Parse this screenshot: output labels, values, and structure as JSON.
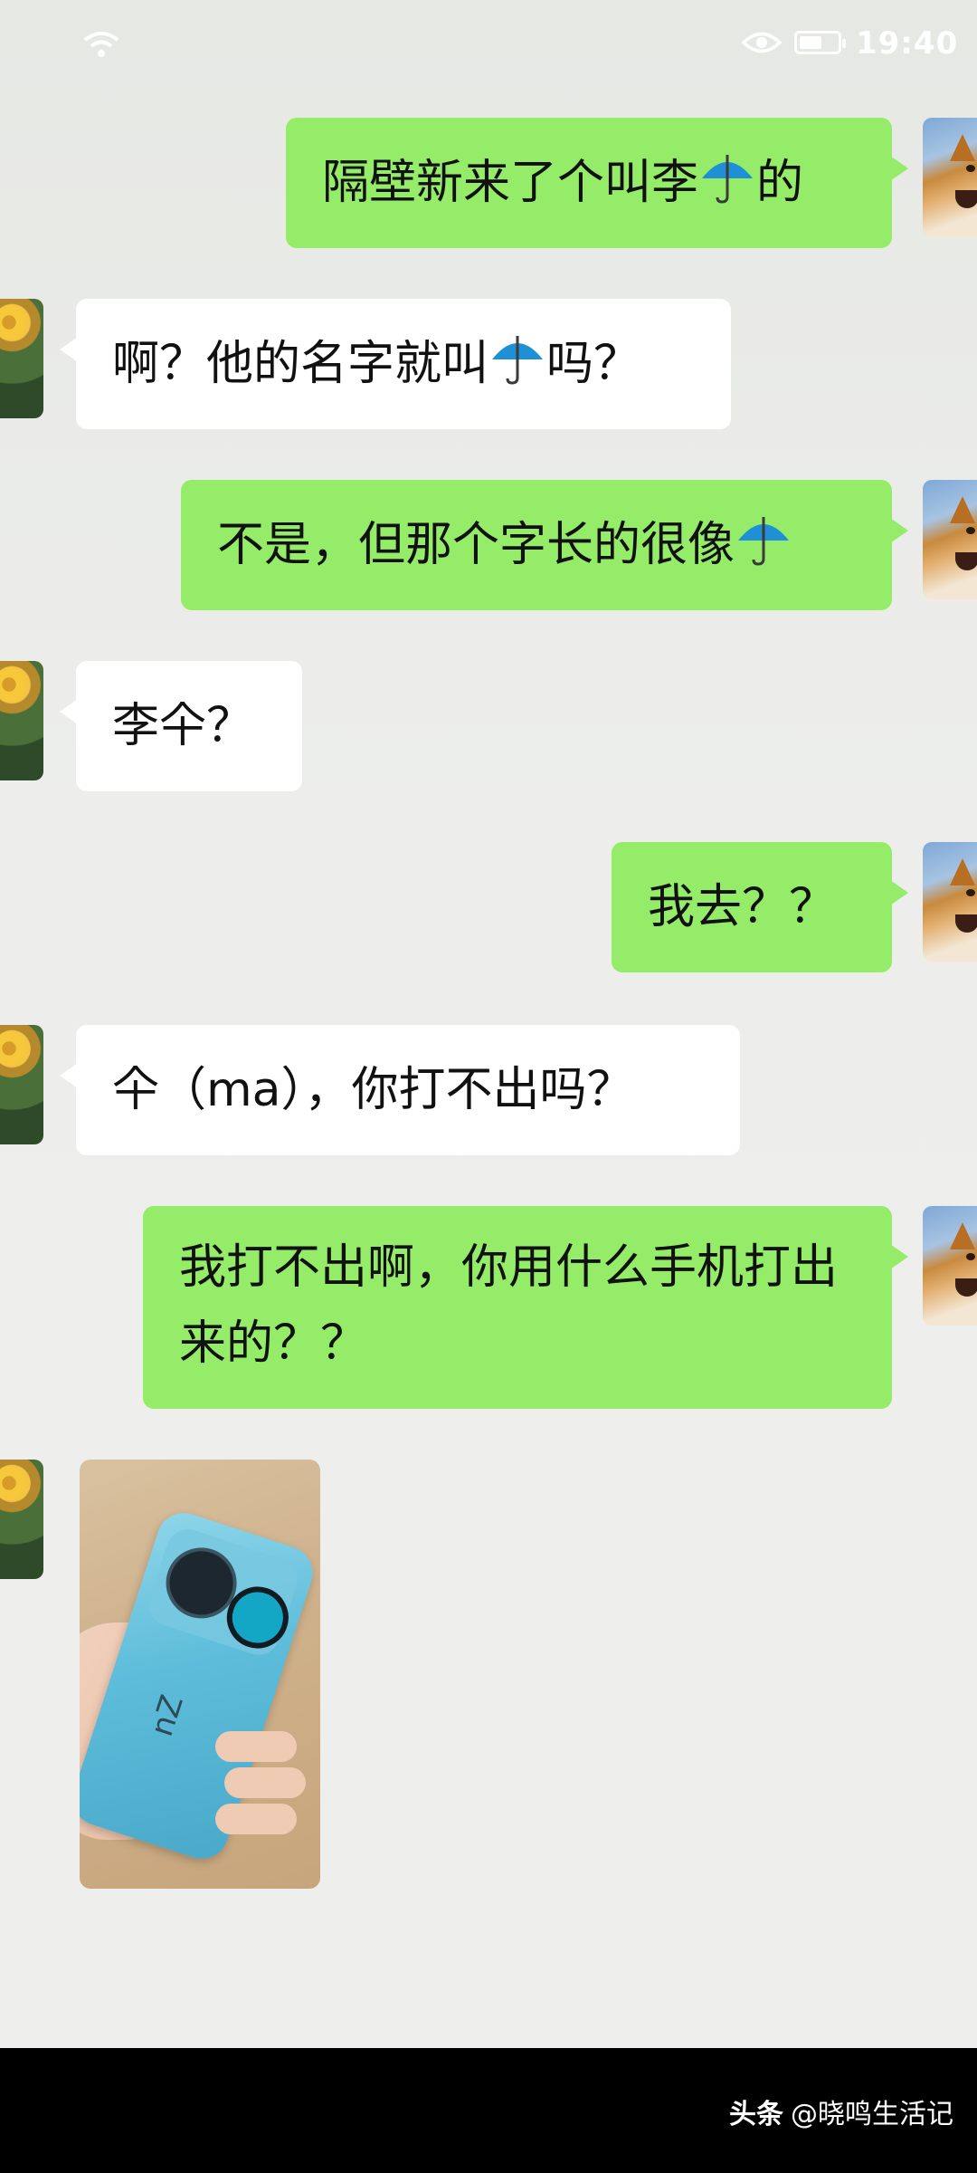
{
  "status_bar": {
    "time": "19:40",
    "battery_level": 0.6
  },
  "messages": [
    {
      "from": "me",
      "parts": [
        "隔壁新来了个叫李",
        "umbrella",
        "的"
      ]
    },
    {
      "from": "them",
      "parts": [
        "啊？他的名字就叫",
        "umbrella",
        "吗？"
      ]
    },
    {
      "from": "me",
      "parts": [
        "不是，但那个字长的很像",
        "umbrella"
      ]
    },
    {
      "from": "them",
      "text": "李仐？"
    },
    {
      "from": "me",
      "text": "我去？？"
    },
    {
      "from": "them",
      "text": "仐（ma），你打不出吗？"
    },
    {
      "from": "me",
      "text": "我打不出啊，你用什么手机打出来的？？"
    },
    {
      "from": "them",
      "type": "image",
      "subject": "phone-photo",
      "phone_brand_text": "nZ"
    }
  ],
  "footer": {
    "app_name": "头条",
    "author": "@晓鸣生活记"
  },
  "colors": {
    "me_bubble": "#95ec69",
    "them_bubble": "#ffffff",
    "background": "#eeefed"
  },
  "icons": {
    "inline_emoji": "umbrella-emoji-icon",
    "status": [
      "wifi-icon",
      "eye-icon",
      "battery-icon"
    ]
  }
}
